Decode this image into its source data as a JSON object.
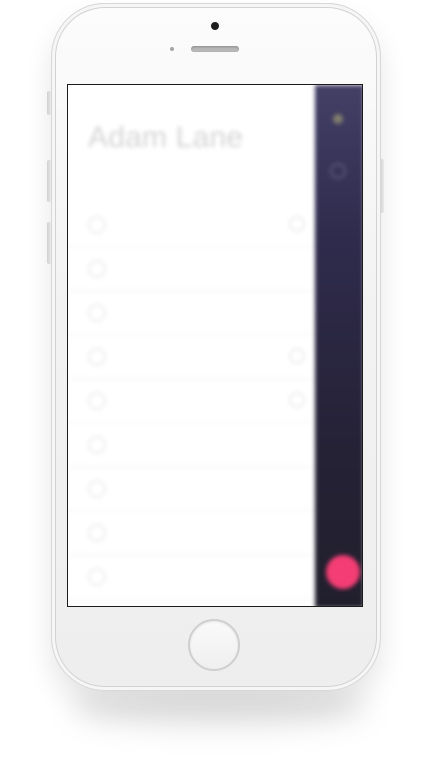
{
  "device": {
    "type": "phone-mockup",
    "color": "#f4f4f4"
  },
  "screen": {
    "drawer": {
      "profile": {
        "name": "Adam Lane",
        "subtitle": ""
      },
      "menu_items": [
        {
          "label": "",
          "icon": "circle-icon",
          "badge": true
        },
        {
          "label": "",
          "icon": "circle-icon",
          "badge": false
        },
        {
          "label": "",
          "icon": "circle-icon",
          "badge": false
        },
        {
          "label": "",
          "icon": "circle-icon",
          "badge": true
        },
        {
          "label": "",
          "icon": "circle-icon",
          "badge": true
        },
        {
          "label": "",
          "icon": "circle-icon",
          "badge": false
        },
        {
          "label": "",
          "icon": "circle-icon",
          "badge": false
        },
        {
          "label": "",
          "icon": "circle-icon",
          "badge": false
        },
        {
          "label": "",
          "icon": "circle-icon",
          "badge": false
        }
      ]
    },
    "right_panel": {
      "accent": "#ff3f78",
      "background": "#2c2840"
    }
  }
}
